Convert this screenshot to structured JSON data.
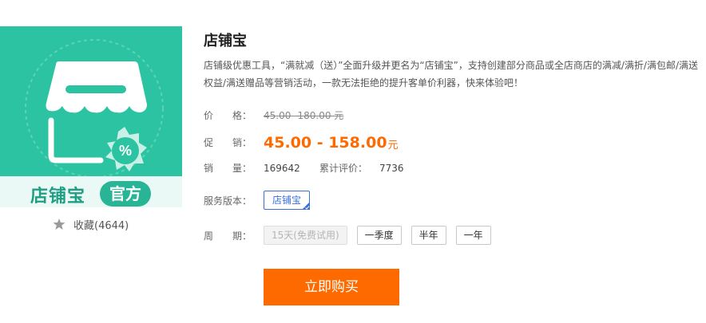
{
  "product": {
    "image_title": "店铺宝",
    "image_badge": "官方",
    "favorite_label": "收藏(4644)",
    "icons": {
      "favorite": "star-icon",
      "store": "storefront-icon",
      "discount": "percent-badge-icon"
    },
    "colors": {
      "image_bg": "#2bc3a1",
      "accent": "#ff6a00",
      "link": "#3a6fd8"
    }
  },
  "info": {
    "title": "店铺宝",
    "description": "店铺级优惠工具，“满就减（送）”全面升级并更名为“店铺宝”，支持创建部分商品或全店商店的满减/满折/满包邮/满送权益/满送赠品等营销活动，一款无法拒绝的提升客单价利器，快来体验吧！",
    "price_label": "价　　格：",
    "price_original": "45.00 -180.00 元",
    "promo_label": "促　　销：",
    "promo_price": "45.00 - 158.00",
    "promo_unit": "元",
    "sales_label": "销　　量：",
    "sales_value": "169642",
    "reviews_label": "累计评价：",
    "reviews_value": "7736",
    "version_label": "服务版本：",
    "version_option": "店铺宝",
    "period_label": "周　　期：",
    "periods": [
      "15天(免费试用)",
      "一季度",
      "半年",
      "一年"
    ],
    "buy_label": "立即购买"
  }
}
